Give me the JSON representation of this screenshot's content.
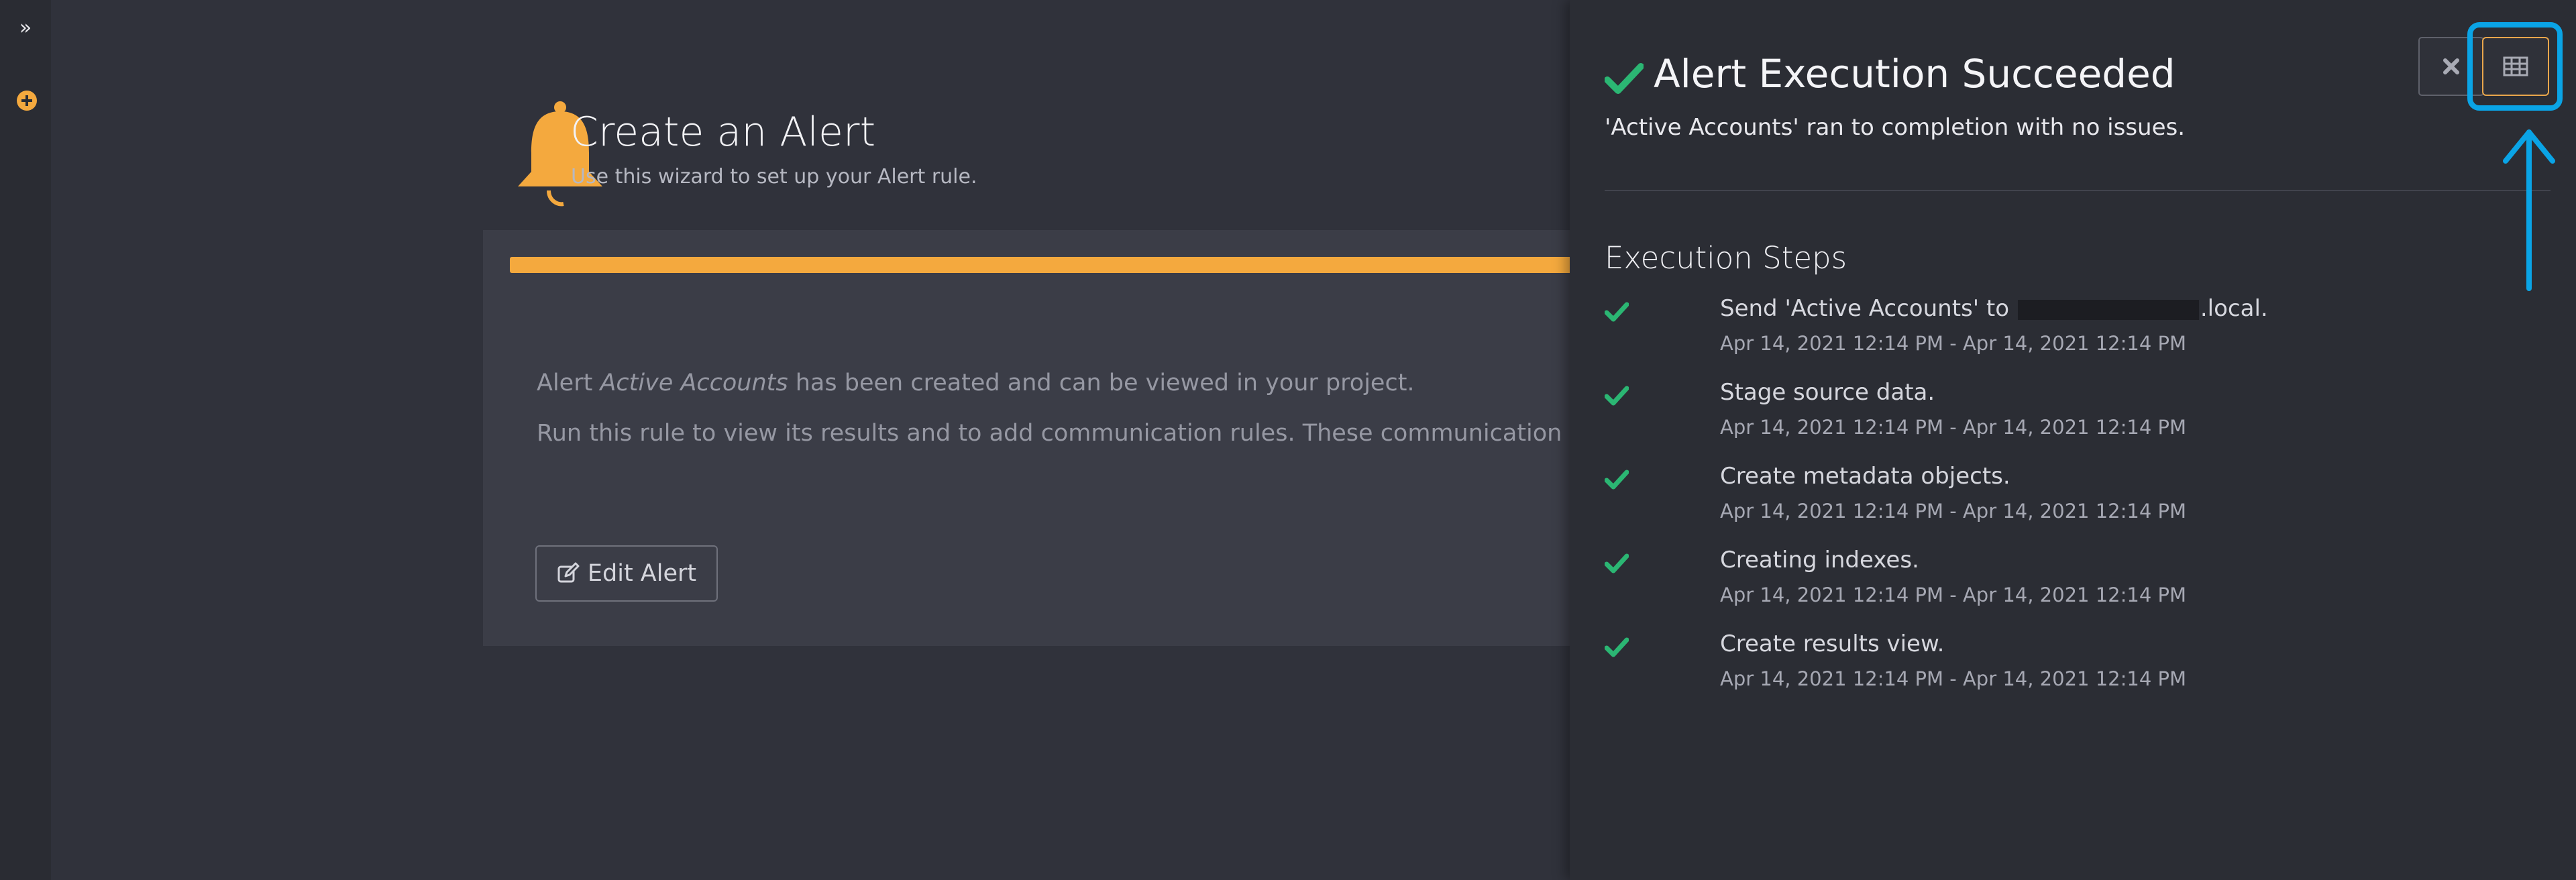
{
  "sidebar": {
    "expand_icon": "double-chevron-right-icon",
    "add_icon": "plus-circle-icon"
  },
  "wizard": {
    "title": "Create an Alert",
    "subtitle": "Use this wizard to set up your Alert rule.",
    "progress": 1.0,
    "message_prefix": "Alert ",
    "alert_name": "Active Accounts",
    "message_suffix": " has been created and can be viewed in your project.",
    "message_run": "Run this rule to view its results and to add communication rules. These communication rules will n",
    "edit_button_label": "Edit Alert"
  },
  "panel": {
    "title": "Alert Execution Succeeded",
    "subtitle": "'Active Accounts' ran to completion with no issues.",
    "steps_title": "Execution Steps",
    "close_icon": "close-icon",
    "table_icon": "table-icon",
    "steps": [
      {
        "title_prefix": "Send 'Active Accounts' to ",
        "title_suffix": ".local.",
        "redacted": true,
        "time": "Apr 14, 2021 12:14 PM - Apr 14, 2021 12:14 PM"
      },
      {
        "title": "Stage source data.",
        "time": "Apr 14, 2021 12:14 PM - Apr 14, 2021 12:14 PM"
      },
      {
        "title": "Create metadata objects.",
        "time": "Apr 14, 2021 12:14 PM - Apr 14, 2021 12:14 PM"
      },
      {
        "title": "Creating indexes.",
        "time": "Apr 14, 2021 12:14 PM - Apr 14, 2021 12:14 PM"
      },
      {
        "title": "Create results view.",
        "time": "Apr 14, 2021 12:14 PM - Apr 14, 2021 12:14 PM"
      }
    ]
  },
  "colors": {
    "accent": "#f4a93e",
    "success": "#2bb673",
    "highlight": "#0aa4e6"
  }
}
